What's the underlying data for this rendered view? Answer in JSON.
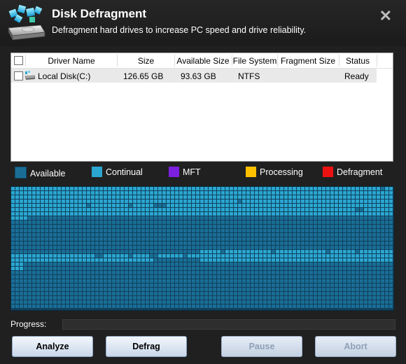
{
  "header": {
    "title": "Disk Defragment",
    "subtitle": "Defragment hard drives to increase PC speed and drive reliability.",
    "close_glyph": "✕"
  },
  "table": {
    "columns": [
      "Driver Name",
      "Size",
      "Available Size",
      "File System",
      "Fragment Size",
      "Status"
    ],
    "rows": [
      {
        "name": "Local Disk(C:)",
        "size": "126.65 GB",
        "available": "93.63 GB",
        "filesystem": "NTFS",
        "fragment": "",
        "status": "Ready",
        "icon": "hard-drive-icon"
      }
    ]
  },
  "legend": [
    {
      "label": "Available",
      "color": "#1a6e96"
    },
    {
      "label": "Continual",
      "color": "#2aa6d0"
    },
    {
      "label": "MFT",
      "color": "#7b1fe0"
    },
    {
      "label": "Processing",
      "color": "#ffc000"
    },
    {
      "label": "Defragment",
      "color": "#ee1111"
    }
  ],
  "progress": {
    "label": "Progress:",
    "value": 0
  },
  "buttons": {
    "analyze": "Analyze",
    "defrag": "Defrag",
    "pause": "Pause",
    "abort": "Abort"
  },
  "colors": {
    "map_available": "#1a6e96",
    "map_continual": "#2aa6d0",
    "map_background": "#11405c"
  }
}
